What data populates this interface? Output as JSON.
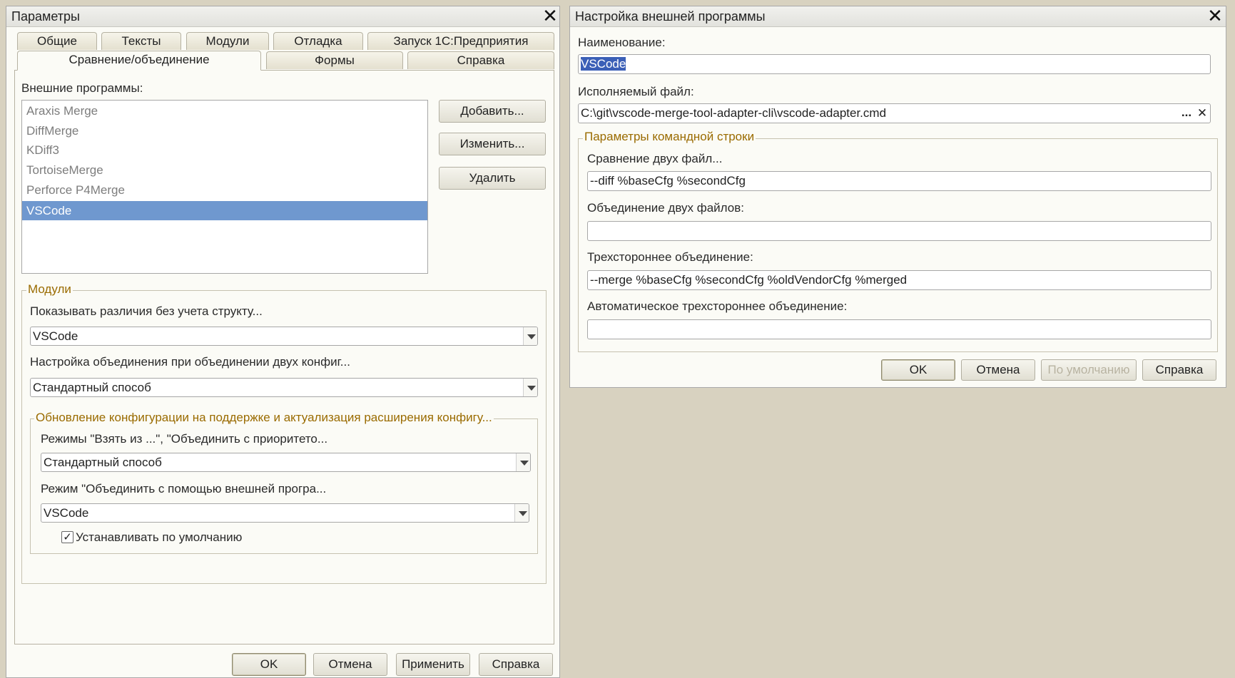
{
  "params_dialog": {
    "title": "Параметры",
    "tabs_row1": [
      "Общие",
      "Тексты",
      "Модули",
      "Отладка",
      "Запуск 1С:Предприятия"
    ],
    "tabs_row2": [
      "Сравнение/объединение",
      "Формы",
      "Справка"
    ],
    "active_tab": "Сравнение/объединение",
    "external_programs_label": "Внешние программы:",
    "programs": [
      "Araxis Merge",
      "DiffMerge",
      "KDiff3",
      "TortoiseMerge",
      "Perforce P4Merge",
      "VSCode"
    ],
    "selected_program": "VSCode",
    "side_buttons": {
      "add": "Добавить...",
      "edit": "Изменить...",
      "delete": "Удалить"
    },
    "modules_group": {
      "title": "Модули",
      "show_diff_label": "Показывать различия без учета структу...",
      "show_diff_value": "VSCode",
      "merge_setting_label": "Настройка объединения при объединении двух конфиг...",
      "merge_setting_value": "Стандартный способ"
    },
    "update_group": {
      "title": "Обновление конфигурации на поддержке и актуализация расширения конфигу...",
      "modes_label": "Режимы \"Взять из ...\", \"Объединить с приоритето...",
      "modes_value": "Стандартный способ",
      "external_mode_label": "Режим \"Объединить с помощью внешней програ...",
      "external_mode_value": "VSCode",
      "default_checkbox_label": "Устанавливать по умолчанию",
      "default_checkbox_checked": true
    },
    "buttons": {
      "ok": "OK",
      "cancel": "Отмена",
      "apply": "Применить",
      "help": "Справка"
    }
  },
  "ext_dialog": {
    "title": "Настройка внешней программы",
    "name_label": "Наименование:",
    "name_value": "VSCode",
    "exe_label": "Исполняемый файл:",
    "exe_value": "C:\\git\\vscode-merge-tool-adapter-cli\\vscode-adapter.cmd",
    "exe_browse": "...",
    "cmd_group_title": "Параметры командной строки",
    "compare_two_label": "Сравнение двух файл...",
    "compare_two_value": "--diff %baseCfg %secondCfg",
    "merge_two_label": "Объединение двух файлов:",
    "merge_two_value": "",
    "three_way_label": "Трехстороннее объединение:",
    "three_way_value": "--merge %baseCfg %secondCfg %oldVendorCfg %merged",
    "auto_three_way_label": "Автоматическое трехстороннее объединение:",
    "auto_three_way_value": "",
    "buttons": {
      "ok": "OK",
      "cancel": "Отмена",
      "default": "По умолчанию",
      "help": "Справка"
    }
  },
  "colors": {
    "selection": "#6f98cf",
    "group_title": "#9a6b00",
    "desktop": "#d8d2c0"
  }
}
